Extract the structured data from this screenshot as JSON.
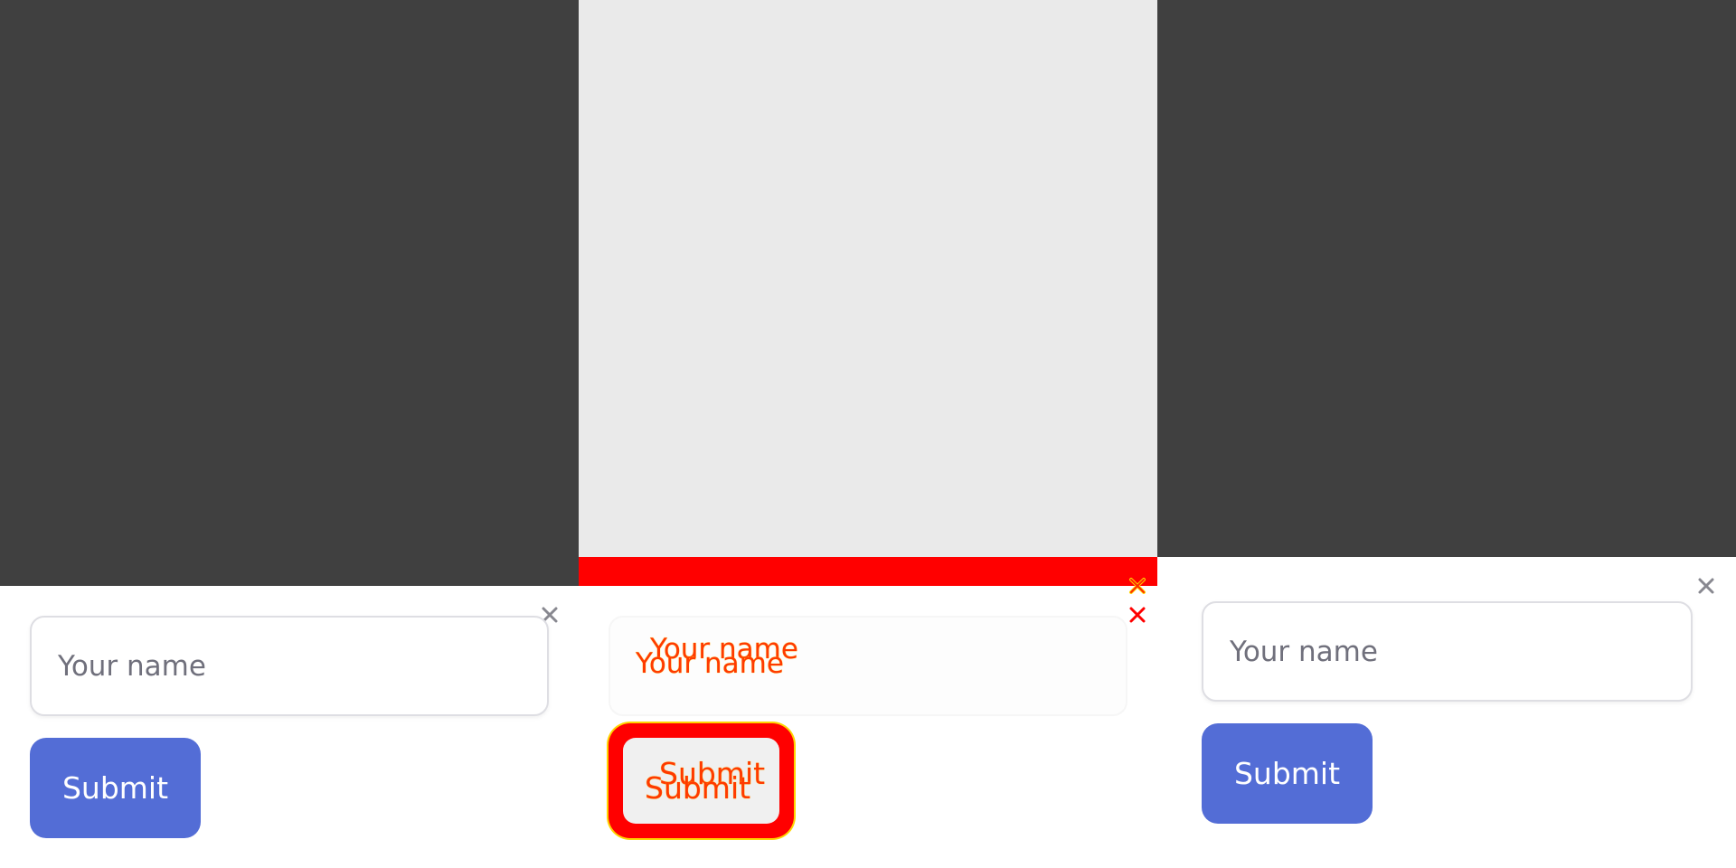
{
  "form": {
    "name_placeholder": "Your name",
    "submit_label": "Submit"
  },
  "colors": {
    "backdrop": "#404040",
    "backdrop_diff": "#eaeaea",
    "accent": "#536dd6",
    "diff_highlight": "#ff0000",
    "placeholder_text": "#70707c",
    "close_icon": "#888890"
  },
  "icons": {
    "close": "close-icon"
  }
}
